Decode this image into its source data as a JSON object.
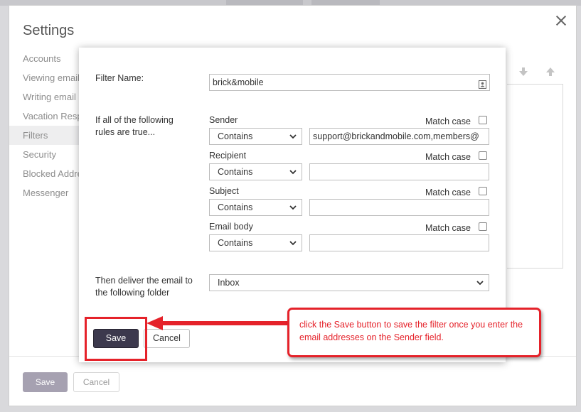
{
  "settings": {
    "title": "Settings",
    "nav": [
      {
        "label": "Accounts",
        "active": false
      },
      {
        "label": "Viewing email",
        "active": false
      },
      {
        "label": "Writing email",
        "active": false
      },
      {
        "label": "Vacation Response",
        "active": false
      },
      {
        "label": "Filters",
        "active": true
      },
      {
        "label": "Security",
        "active": false
      },
      {
        "label": "Blocked Addresses",
        "active": false
      },
      {
        "label": "Messenger",
        "active": false
      }
    ],
    "save_label": "Save",
    "cancel_label": "Cancel"
  },
  "filter": {
    "name_label": "Filter Name:",
    "name_value": "brick&mobile",
    "rules_label": "If all of the following rules are true...",
    "match_case_label": "Match case",
    "rules": [
      {
        "field": "Sender",
        "operator": "Contains",
        "value": "support@brickandmobile.com,members@"
      },
      {
        "field": "Recipient",
        "operator": "Contains",
        "value": ""
      },
      {
        "field": "Subject",
        "operator": "Contains",
        "value": ""
      },
      {
        "field": "Email body",
        "operator": "Contains",
        "value": ""
      }
    ],
    "deliver_label": "Then deliver the email to the following folder",
    "folder": "Inbox",
    "save_label": "Save",
    "cancel_label": "Cancel"
  },
  "annotation": {
    "text": "click the Save button to save the filter once you enter the email addresses on the Sender field.",
    "color": "#e5222a"
  },
  "icons": [
    "close-icon",
    "contact-card-icon",
    "chevron-down-icon",
    "arrow-down-icon",
    "arrow-up-icon"
  ]
}
